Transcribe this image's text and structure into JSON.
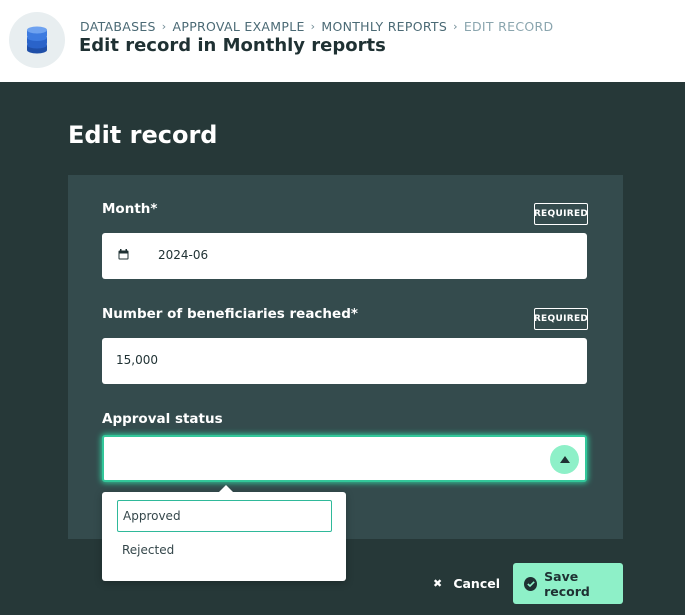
{
  "header": {
    "breadcrumb": [
      "DATABASES",
      "APPROVAL EXAMPLE",
      "MONTHLY REPORTS",
      "EDIT RECORD"
    ],
    "title": "Edit record in Monthly reports",
    "icon": "database-icon"
  },
  "form": {
    "heading": "Edit record",
    "required_badge": "REQUIRED",
    "month": {
      "label": "Month*",
      "value": "2024-06",
      "icon": "calendar-icon"
    },
    "beneficiaries": {
      "label": "Number of beneficiaries reached*",
      "value": "15,000"
    },
    "approval": {
      "label": "Approval status",
      "value": "",
      "options": [
        "Approved",
        "Rejected"
      ],
      "toggle_icon": "caret-up-icon"
    }
  },
  "actions": {
    "cancel_label": "Cancel",
    "save_label": "Save record"
  },
  "colors": {
    "background": "#263838",
    "card": "#344b4d",
    "accent": "#8ef0c8",
    "focus": "#33c79a",
    "header_bg": "#ffffff"
  }
}
